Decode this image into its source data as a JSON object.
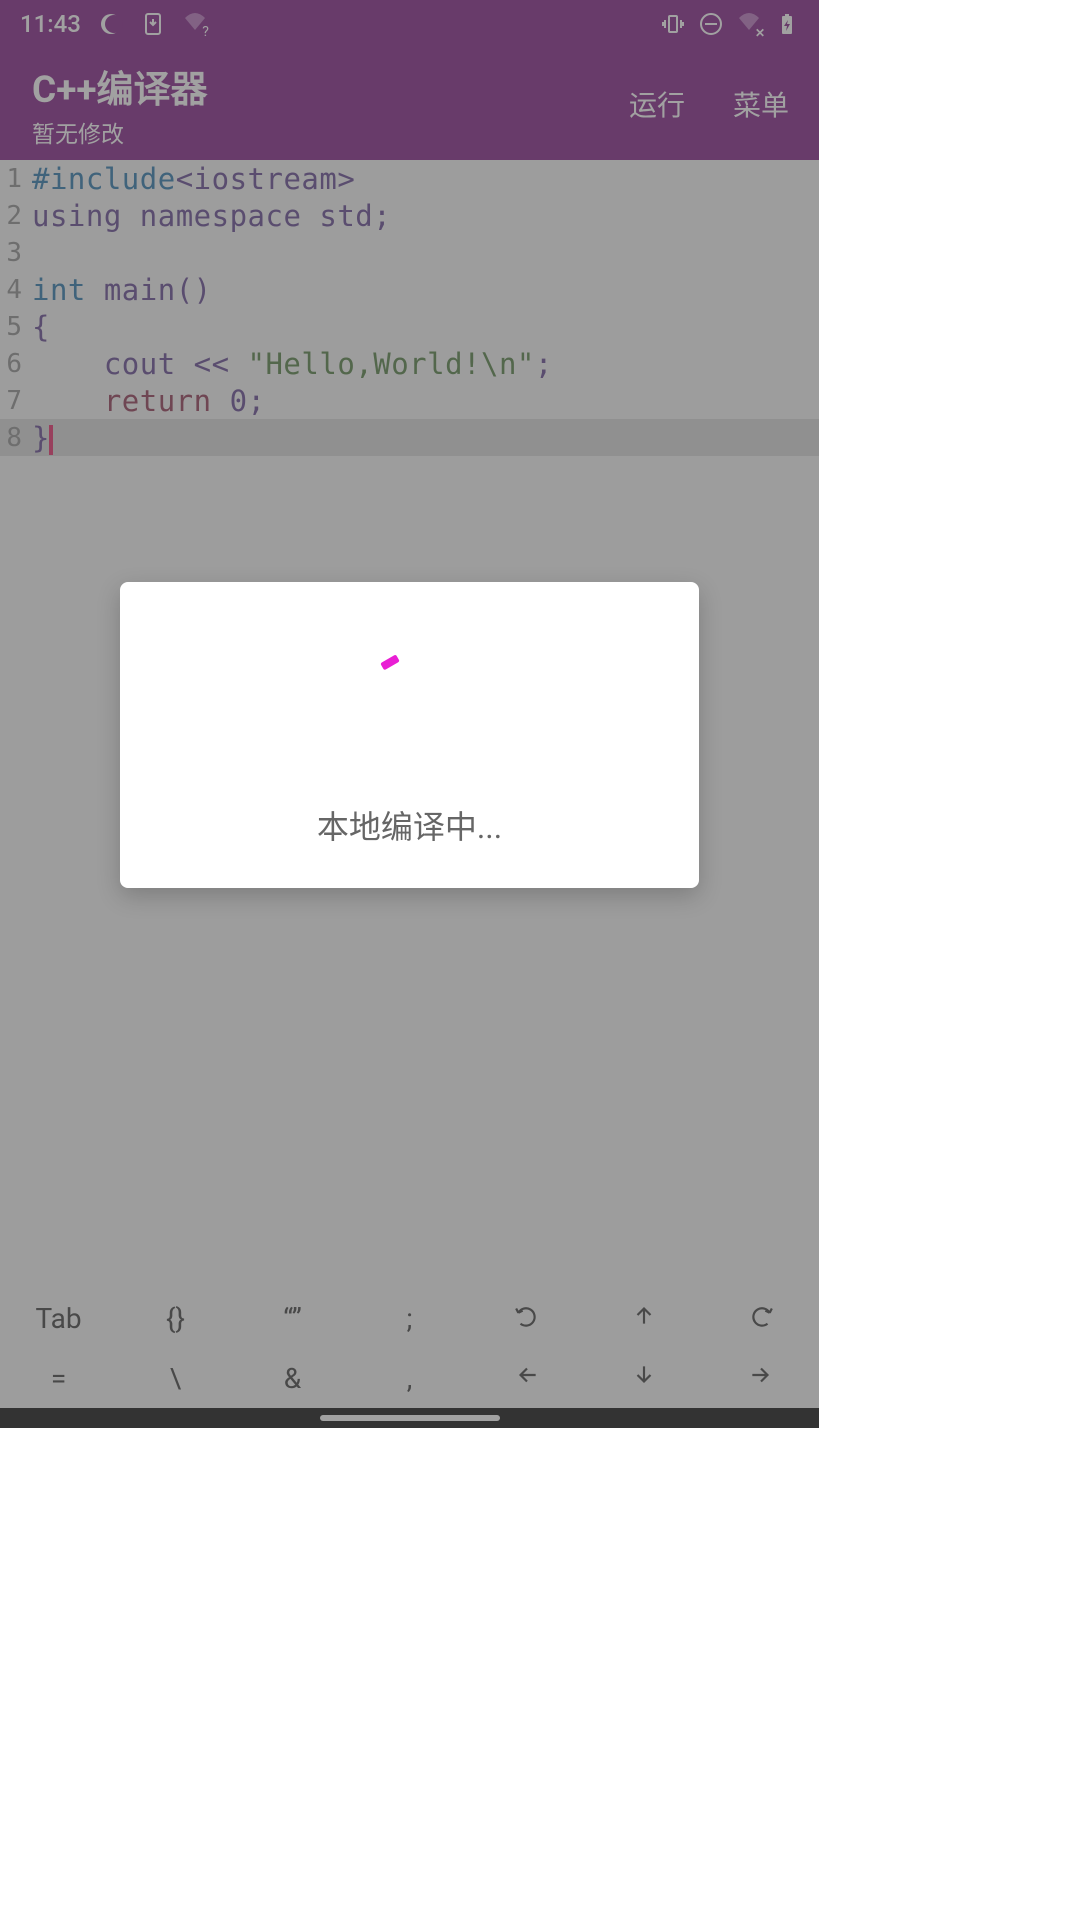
{
  "statusbar": {
    "time": "11:43"
  },
  "header": {
    "title": "C++编译器",
    "subtitle": "暂无修改",
    "actions": {
      "run": "运行",
      "menu": "菜单"
    }
  },
  "editor": {
    "lines": [
      {
        "n": "1",
        "tokens": [
          {
            "t": "#include",
            "c": "preproc"
          },
          {
            "t": "<iostream>",
            "c": "angle"
          }
        ]
      },
      {
        "n": "2",
        "tokens": [
          {
            "t": "using",
            "c": "keyword"
          },
          {
            "t": " ",
            "c": "default"
          },
          {
            "t": "namespace",
            "c": "keyword"
          },
          {
            "t": " std;",
            "c": "default"
          }
        ]
      },
      {
        "n": "3",
        "tokens": []
      },
      {
        "n": "4",
        "tokens": [
          {
            "t": "int",
            "c": "type"
          },
          {
            "t": " main()",
            "c": "default"
          }
        ]
      },
      {
        "n": "5",
        "tokens": [
          {
            "t": "{",
            "c": "default"
          }
        ]
      },
      {
        "n": "6",
        "tokens": [
          {
            "t": "    cout << ",
            "c": "default"
          },
          {
            "t": "\"Hello,World!\\n\"",
            "c": "string"
          },
          {
            "t": ";",
            "c": "default"
          }
        ]
      },
      {
        "n": "7",
        "tokens": [
          {
            "t": "    ",
            "c": "default"
          },
          {
            "t": "return",
            "c": "return"
          },
          {
            "t": " 0;",
            "c": "default"
          }
        ]
      },
      {
        "n": "8",
        "tokens": [
          {
            "t": "}",
            "c": "default"
          }
        ],
        "cursor": true,
        "hl": true
      }
    ]
  },
  "toolbar": {
    "row1": [
      "Tab",
      "{}",
      "“”",
      ";",
      "undo-icon",
      "up-arrow-icon",
      "redo-icon"
    ],
    "row2": [
      "=",
      "\\",
      "&",
      ",",
      "left-arrow-icon",
      "down-arrow-icon",
      "right-arrow-icon"
    ]
  },
  "modal": {
    "text": "本地编译中..."
  }
}
